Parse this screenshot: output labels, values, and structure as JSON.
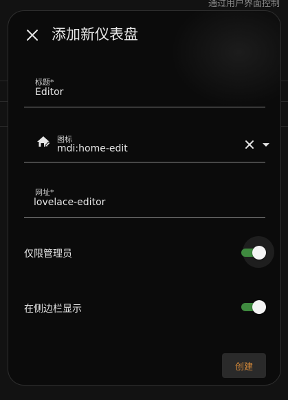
{
  "background": {
    "top_right_text": "通过用户界面控制"
  },
  "dialog": {
    "title": "添加新仪表盘",
    "close_icon": "close-icon",
    "fields": {
      "title": {
        "label": "标题*",
        "value": "Editor"
      },
      "icon": {
        "label": "图标",
        "value": "mdi:home-edit",
        "icon": "home-edit-icon"
      },
      "url": {
        "label": "网址*",
        "value": " lovelace-editor"
      }
    },
    "toggles": {
      "admin_only": {
        "label": "仅限管理员",
        "on": true
      },
      "show_sidebar": {
        "label": "在侧边栏显示",
        "on": true
      }
    },
    "create_label": "创建"
  },
  "colors": {
    "accent_orange": "#d98c3a",
    "switch_on": "#3f8a3f"
  }
}
